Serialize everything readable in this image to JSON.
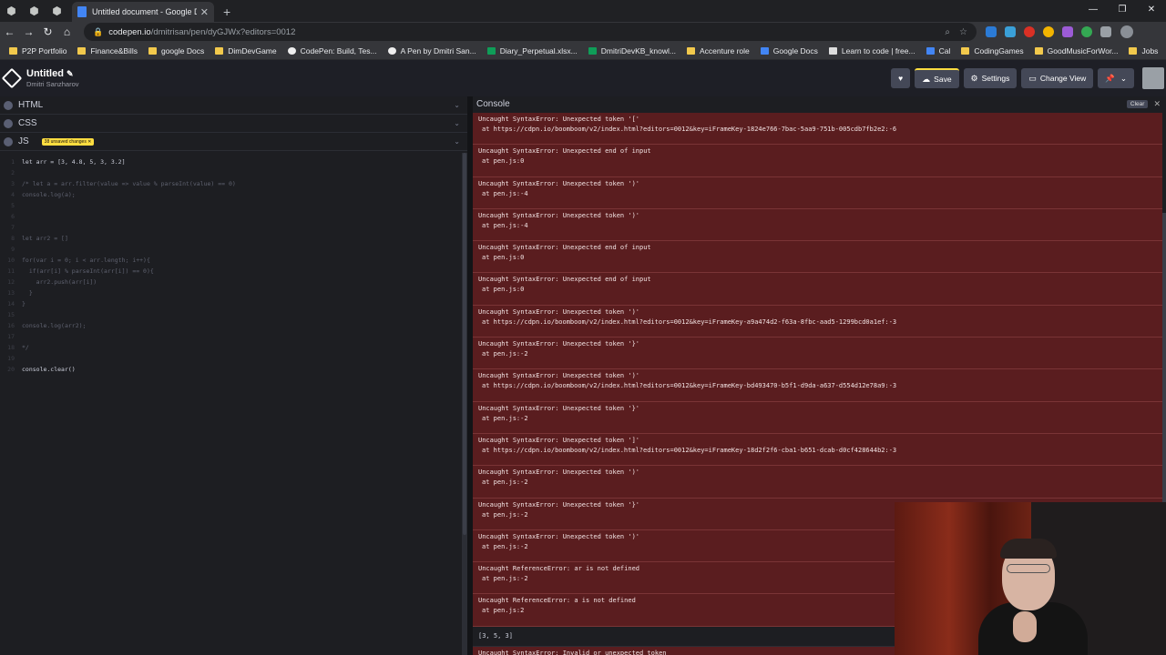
{
  "browser": {
    "active_tab_title": "Untitled document - Google Do",
    "url_host": "codepen.io",
    "url_path": "/dmitrisan/pen/dyGJWx?editors=0012",
    "bookmarks": [
      "P2P Portfolio",
      "Finance&Bills",
      "google Docs",
      "DimDevGame",
      "CodePen: Build, Tes...",
      "A Pen by Dmitri San...",
      "Diary_Perpetual.xlsx...",
      "DmitriDevKB_knowl...",
      "Accenture role",
      "Google Docs",
      "Learn to code | free...",
      "Cal",
      "CodingGames",
      "GoodMusicForWor...",
      "Jobs"
    ]
  },
  "codepen": {
    "title": "Untitled",
    "author": "Dmitri Sanzharov",
    "save_label": "Save",
    "settings_label": "Settings",
    "change_view_label": "Change View"
  },
  "editors": {
    "html_label": "HTML",
    "css_label": "CSS",
    "js_label": "JS",
    "js_badge": "38 unsaved changes ✕"
  },
  "code_lines": [
    {
      "n": "1",
      "t": "let arr = [3, 4.8, 5, 3, 3.2]",
      "c": "tx"
    },
    {
      "n": "2",
      "t": "",
      "c": "tx"
    },
    {
      "n": "3",
      "t": "/* let a = arr.filter(value => value % parseInt(value) == 0)",
      "c": "cm"
    },
    {
      "n": "4",
      "t": "console.log(a);",
      "c": "cm"
    },
    {
      "n": "5",
      "t": "",
      "c": "cm"
    },
    {
      "n": "6",
      "t": "",
      "c": "cm"
    },
    {
      "n": "7",
      "t": "",
      "c": "cm"
    },
    {
      "n": "8",
      "t": "let arr2 = []",
      "c": "cm"
    },
    {
      "n": "9",
      "t": "",
      "c": "cm"
    },
    {
      "n": "10",
      "t": "for(var i = 0; i < arr.length; i++){",
      "c": "cm"
    },
    {
      "n": "11",
      "t": "  if(arr[i] % parseInt(arr[i]) == 0){",
      "c": "cm"
    },
    {
      "n": "12",
      "t": "    arr2.push(arr[i])",
      "c": "cm"
    },
    {
      "n": "13",
      "t": "  }",
      "c": "cm"
    },
    {
      "n": "14",
      "t": "}",
      "c": "cm"
    },
    {
      "n": "15",
      "t": "",
      "c": "cm"
    },
    {
      "n": "16",
      "t": "console.log(arr2);",
      "c": "cm"
    },
    {
      "n": "17",
      "t": "",
      "c": "cm"
    },
    {
      "n": "18",
      "t": "*/",
      "c": "cm"
    },
    {
      "n": "19",
      "t": "",
      "c": "cm"
    },
    {
      "n": "20",
      "t": "console.clear()",
      "c": "tx"
    }
  ],
  "console": {
    "title": "Console",
    "clear_label": "Clear",
    "entries": [
      {
        "kind": "error",
        "msg": "Uncaught SyntaxError: Unexpected token '['",
        "at": "at https://cdpn.io/boomboom/v2/index.html?editors=0012&key=iFrameKey-1824e766-7bac-5aa9-751b-005cdb7fb2e2:-6"
      },
      {
        "kind": "error",
        "msg": "Uncaught SyntaxError: Unexpected end of input",
        "at": "at pen.js:0"
      },
      {
        "kind": "error",
        "msg": "Uncaught SyntaxError: Unexpected token ')'",
        "at": "at pen.js:-4"
      },
      {
        "kind": "error",
        "msg": "Uncaught SyntaxError: Unexpected token ')'",
        "at": "at pen.js:-4"
      },
      {
        "kind": "error",
        "msg": "Uncaught SyntaxError: Unexpected end of input",
        "at": "at pen.js:0"
      },
      {
        "kind": "error",
        "msg": "Uncaught SyntaxError: Unexpected end of input",
        "at": "at pen.js:0"
      },
      {
        "kind": "error",
        "msg": "Uncaught SyntaxError: Unexpected token ')'",
        "at": "at https://cdpn.io/boomboom/v2/index.html?editors=0012&key=iFrameKey-a9a474d2-f63a-8fbc-aad5-1299bcd0a1ef:-3"
      },
      {
        "kind": "error",
        "msg": "Uncaught SyntaxError: Unexpected token '}'",
        "at": "at pen.js:-2"
      },
      {
        "kind": "error",
        "msg": "Uncaught SyntaxError: Unexpected token ')'",
        "at": "at https://cdpn.io/boomboom/v2/index.html?editors=0012&key=iFrameKey-bd493470-b5f1-d9da-a637-d554d12e78a9:-3"
      },
      {
        "kind": "error",
        "msg": "Uncaught SyntaxError: Unexpected token '}'",
        "at": "at pen.js:-2"
      },
      {
        "kind": "error",
        "msg": "Uncaught SyntaxError: Unexpected token ']'",
        "at": "at https://cdpn.io/boomboom/v2/index.html?editors=0012&key=iFrameKey-18d2f2f6-cba1-b651-dcab-d0cf428644b2:-3"
      },
      {
        "kind": "error",
        "msg": "Uncaught SyntaxError: Unexpected token ')'",
        "at": "at pen.js:-2"
      },
      {
        "kind": "error",
        "msg": "Uncaught SyntaxError: Unexpected token '}'",
        "at": "at pen.js:-2"
      },
      {
        "kind": "error",
        "msg": "Uncaught SyntaxError: Unexpected token ')'",
        "at": "at pen.js:-2"
      },
      {
        "kind": "error",
        "msg": "Uncaught ReferenceError: ar is not defined",
        "at": "at pen.js:-2"
      },
      {
        "kind": "error",
        "msg": "Uncaught ReferenceError: a is not defined",
        "at": "at pen.js:2"
      },
      {
        "kind": "log",
        "msg": "[3, 5, 3]",
        "at": ""
      },
      {
        "kind": "error",
        "msg": "Uncaught SyntaxError: Invalid or unexpected token",
        "at": ""
      }
    ]
  }
}
